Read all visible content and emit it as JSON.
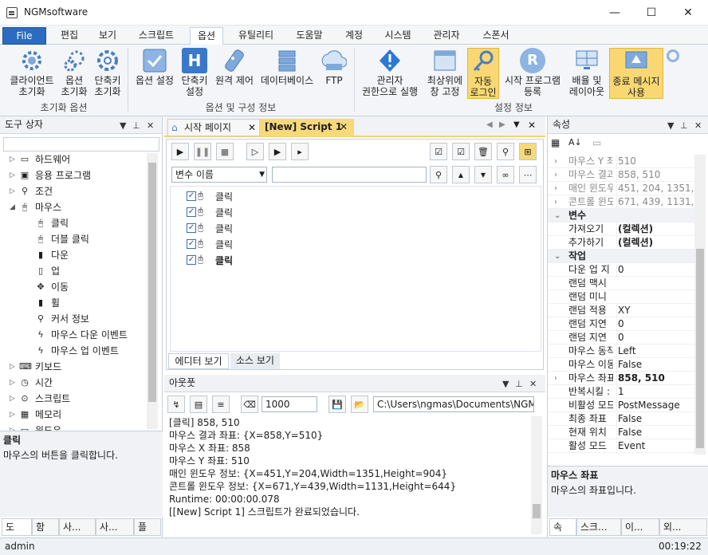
{
  "window": {
    "title": "NGMsoftware",
    "min": "—",
    "max": "☐",
    "close": "✕"
  },
  "ribbon_tabs": [
    "File",
    "편집",
    "보기",
    "스크립트",
    "옵션",
    "유틸리티",
    "도움말",
    "계정",
    "시스템",
    "관리자",
    "스폰서"
  ],
  "ribbon": {
    "buttons": [
      {
        "label1": "클라이언트",
        "label2": "초기화"
      },
      {
        "label1": "옵션",
        "label2": "초기화"
      },
      {
        "label1": "단축키",
        "label2": "초기화"
      },
      {
        "label1": "옵션 설정",
        "label2": ""
      },
      {
        "label1": "단축키",
        "label2": "설정"
      },
      {
        "label1": "원격 제어",
        "label2": ""
      },
      {
        "label1": "데이터베이스",
        "label2": ""
      },
      {
        "label1": "FTP",
        "label2": ""
      },
      {
        "label1": "관리자",
        "label2": "권한으로 실행"
      },
      {
        "label1": "최상위에",
        "label2": "창 고정"
      },
      {
        "label1": "자동",
        "label2": "로그인"
      },
      {
        "label1": "시작 프로그램",
        "label2": "등록"
      },
      {
        "label1": "배율 및",
        "label2": "레이아웃"
      },
      {
        "label1": "종료 메시지",
        "label2": "사용"
      }
    ],
    "groups": [
      "초기화 옵션",
      "옵션 및 구성 정보",
      "설정 정보"
    ],
    "icon_h": "H",
    "icon_r": "R"
  },
  "toolbox": {
    "title": "도구 상자",
    "items": [
      {
        "label": "하드웨어",
        "icon": "▭",
        "arrow": "▷"
      },
      {
        "label": "응용 프로그램",
        "icon": "▣",
        "arrow": "▷"
      },
      {
        "label": "조건",
        "icon": "⚲",
        "arrow": "▷"
      },
      {
        "label": "마우스",
        "icon": "🖰",
        "arrow": "◢"
      },
      {
        "label": "클릭",
        "icon": "🖰",
        "arrow": ""
      },
      {
        "label": "더블 클릭",
        "icon": "🖰",
        "arrow": ""
      },
      {
        "label": "다운",
        "icon": "▮",
        "arrow": ""
      },
      {
        "label": "업",
        "icon": "▯",
        "arrow": ""
      },
      {
        "label": "이동",
        "icon": "✥",
        "arrow": ""
      },
      {
        "label": "휠",
        "icon": "▮",
        "arrow": ""
      },
      {
        "label": "커서 정보",
        "icon": "⚲",
        "arrow": ""
      },
      {
        "label": "마우스 다운 이벤트",
        "icon": "ϟ",
        "arrow": ""
      },
      {
        "label": "마우스 업 이벤트",
        "icon": "ϟ",
        "arrow": ""
      },
      {
        "label": "키보드",
        "icon": "⌨",
        "arrow": "▷"
      },
      {
        "label": "시간",
        "icon": "◷",
        "arrow": "▷"
      },
      {
        "label": "스크립트",
        "icon": "⊙",
        "arrow": "▷"
      },
      {
        "label": "메모리",
        "icon": "▦",
        "arrow": "▷"
      },
      {
        "label": "윈도우",
        "icon": "▭",
        "arrow": "▷"
      }
    ],
    "desc_title": "클릭",
    "desc_text": "마우스의 버튼을 클릭합니다.",
    "bottom_tabs": [
      "도",
      "함",
      "사...",
      "사...",
      "플"
    ]
  },
  "editor": {
    "tabs": [
      {
        "label": "시작 페이지"
      },
      {
        "label": "[New] Script 1"
      }
    ],
    "var_select": "변수 이름",
    "var_input": "",
    "lines": [
      "클릭",
      "클릭",
      "클릭",
      "클릭",
      "클릭"
    ],
    "view_tabs": [
      "에디터 보기",
      "소스 보기"
    ]
  },
  "output": {
    "title": "아웃풋",
    "count": "1000",
    "path": "C:\\Users\\ngmas\\Documents\\NGM6\\",
    "lines": [
      "[클릭] 858, 510",
      "마우스 결과 좌표: {X=858,Y=510}",
      "마우스 X 좌표: 858",
      "마우스 Y 좌표: 510",
      "매인 윈도우 정보: {X=451,Y=204,Width=1351,Height=904}",
      "콘트롤 윈도우 정보: {X=671,Y=439,Width=1131,Height=644}",
      "Runtime: 00:00:00.078",
      "[[New] Script 1] 스크립트가 완료되었습니다."
    ]
  },
  "properties": {
    "title": "속성",
    "rows": [
      {
        "name": "마우스 Y 좌",
        "value": "510",
        "type": "gray"
      },
      {
        "name": "마우스 결과",
        "value": "858, 510",
        "type": "gray"
      },
      {
        "name": "매인 윈도우",
        "value": "451, 204, 1351, 90",
        "type": "gray"
      },
      {
        "name": "콘트롤 윈도",
        "value": "671, 439, 1131, 64",
        "type": "gray"
      },
      {
        "name": "변수",
        "value": "",
        "type": "cat"
      },
      {
        "name": "가져오기",
        "value": "(컬렉션)",
        "type": "bold"
      },
      {
        "name": "추가하기",
        "value": "(컬렉션)",
        "type": "bold"
      },
      {
        "name": "작업",
        "value": "",
        "type": "cat"
      },
      {
        "name": "다운 업 지",
        "value": "0",
        "type": ""
      },
      {
        "name": "랜덤 맥시",
        "value": "",
        "type": ""
      },
      {
        "name": "랜덤 미니",
        "value": "",
        "type": ""
      },
      {
        "name": "랜덤 적용",
        "value": "XY",
        "type": ""
      },
      {
        "name": "랜덤 지연",
        "value": "0",
        "type": ""
      },
      {
        "name": "랜덤 지연",
        "value": "0",
        "type": ""
      },
      {
        "name": "마우스 동작",
        "value": "Left",
        "type": ""
      },
      {
        "name": "마우스 이동",
        "value": "False",
        "type": ""
      },
      {
        "name": "마우스 좌표",
        "value": "858, 510",
        "type": "boldv"
      },
      {
        "name": "반복시킬 :",
        "value": "1",
        "type": ""
      },
      {
        "name": "비활성 모드",
        "value": "PostMessage",
        "type": ""
      },
      {
        "name": "최종 좌표",
        "value": "False",
        "type": ""
      },
      {
        "name": "현재 위치",
        "value": "False",
        "type": ""
      },
      {
        "name": "활성 모드",
        "value": "Event",
        "type": ""
      }
    ],
    "desc_title": "마우스 좌표",
    "desc_text": "마우스의 좌표입니다.",
    "bottom_tabs": [
      "속",
      "스크...",
      "이...",
      "외..."
    ]
  },
  "status": {
    "user": "admin",
    "time": "00:19:22"
  }
}
